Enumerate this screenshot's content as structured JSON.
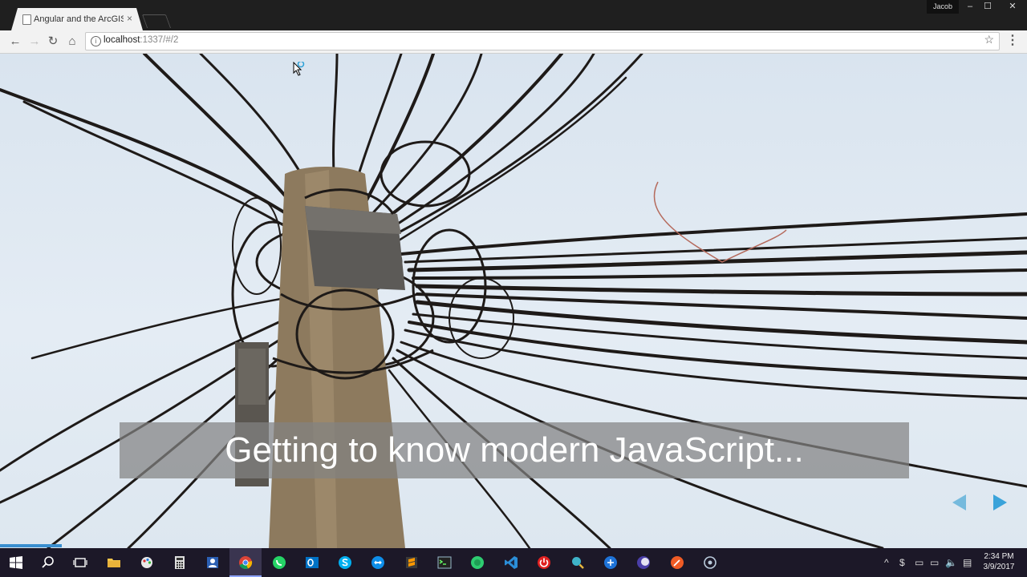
{
  "browser": {
    "tab_title": "Angular and the ArcGIS /",
    "tab_close": "×",
    "profile_name": "Jacob",
    "window_controls": {
      "minimize": "–",
      "maximize": "☐",
      "close": "✕"
    },
    "url_host": "localhost",
    "url_rest": ":1337/#/2",
    "star": "☆",
    "menu": "⋮",
    "nav": {
      "back": "←",
      "forward": "→",
      "reload": "↻",
      "home": "⌂"
    }
  },
  "slide": {
    "caption": "Getting to know modern JavaScript...",
    "progress_fraction": 0.06,
    "colors": {
      "arrow": "#3aa3da",
      "progress": "#3a8fd0"
    }
  },
  "taskbar": {
    "icons": [
      "windows-start-icon",
      "search-icon",
      "task-view-icon",
      "file-explorer-icon",
      "paint-icon",
      "calculator-icon",
      "contacts-icon",
      "chrome-icon",
      "whatsapp-icon",
      "outlook-icon",
      "skype-icon",
      "teamviewer-icon",
      "sublime-text-icon",
      "terminal-icon",
      "chat-icon",
      "vscode-icon",
      "power-icon",
      "magnifier-icon",
      "network-icon",
      "eclipse-icon",
      "postman-icon",
      "settings-icon"
    ],
    "tray_symbols": {
      "chevron": "^",
      "dollar": "$",
      "battery": "▭",
      "display": "▭",
      "speaker": "🔈",
      "notifications": "▤"
    },
    "time": "2:34 PM",
    "date": "3/9/2017"
  }
}
